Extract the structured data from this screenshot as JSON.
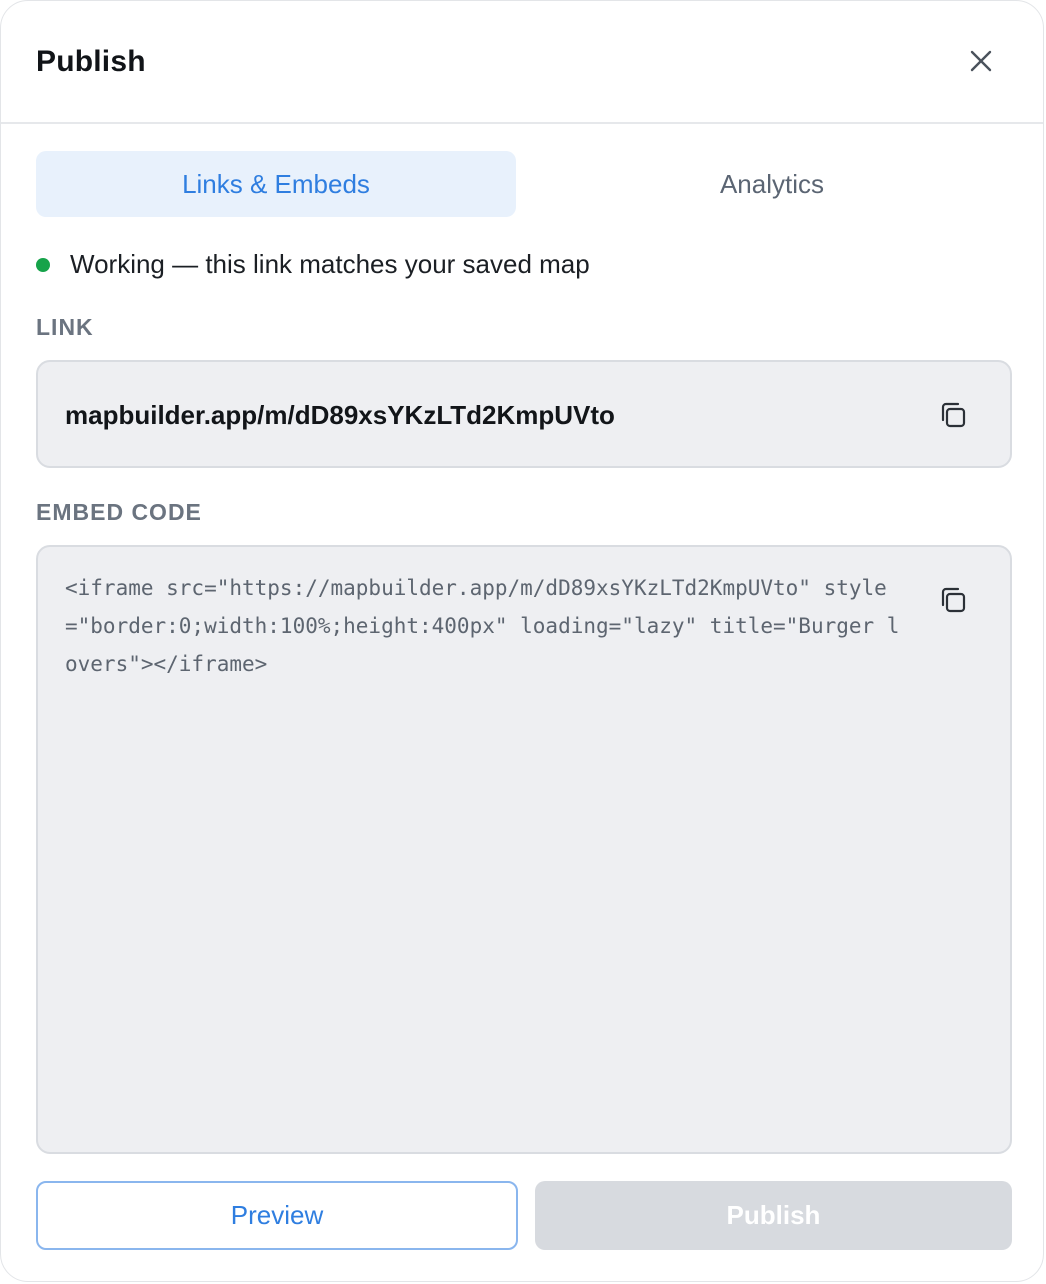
{
  "dialog": {
    "title": "Publish",
    "close_icon": "close-icon"
  },
  "tabs": [
    {
      "label": "Links & Embeds",
      "active": true
    },
    {
      "label": "Analytics",
      "active": false
    }
  ],
  "status": {
    "text": "Working — this link matches your saved map",
    "color": "#16a34a"
  },
  "link": {
    "label": "LINK",
    "value": "mapbuilder.app/m/dD89xsYKzLTd2KmpUVto",
    "copy_icon": "copy-icon"
  },
  "embed": {
    "label": "EMBED CODE",
    "code": "<iframe src=\"https://mapbuilder.app/m/dD89xsYKzLTd2KmpUVto\" style=\"border:0;width:100%;height:400px\" loading=\"lazy\" title=\"Burger lovers\"></iframe>",
    "copy_icon": "copy-icon"
  },
  "footer": {
    "preview_label": "Preview",
    "publish_label": "Publish",
    "publish_disabled": true
  },
  "colors": {
    "accent": "#2f7ee0",
    "tab_active_bg": "#e8f1fc",
    "box_bg": "#eeeff2",
    "disabled_bg": "#d7dadf"
  }
}
